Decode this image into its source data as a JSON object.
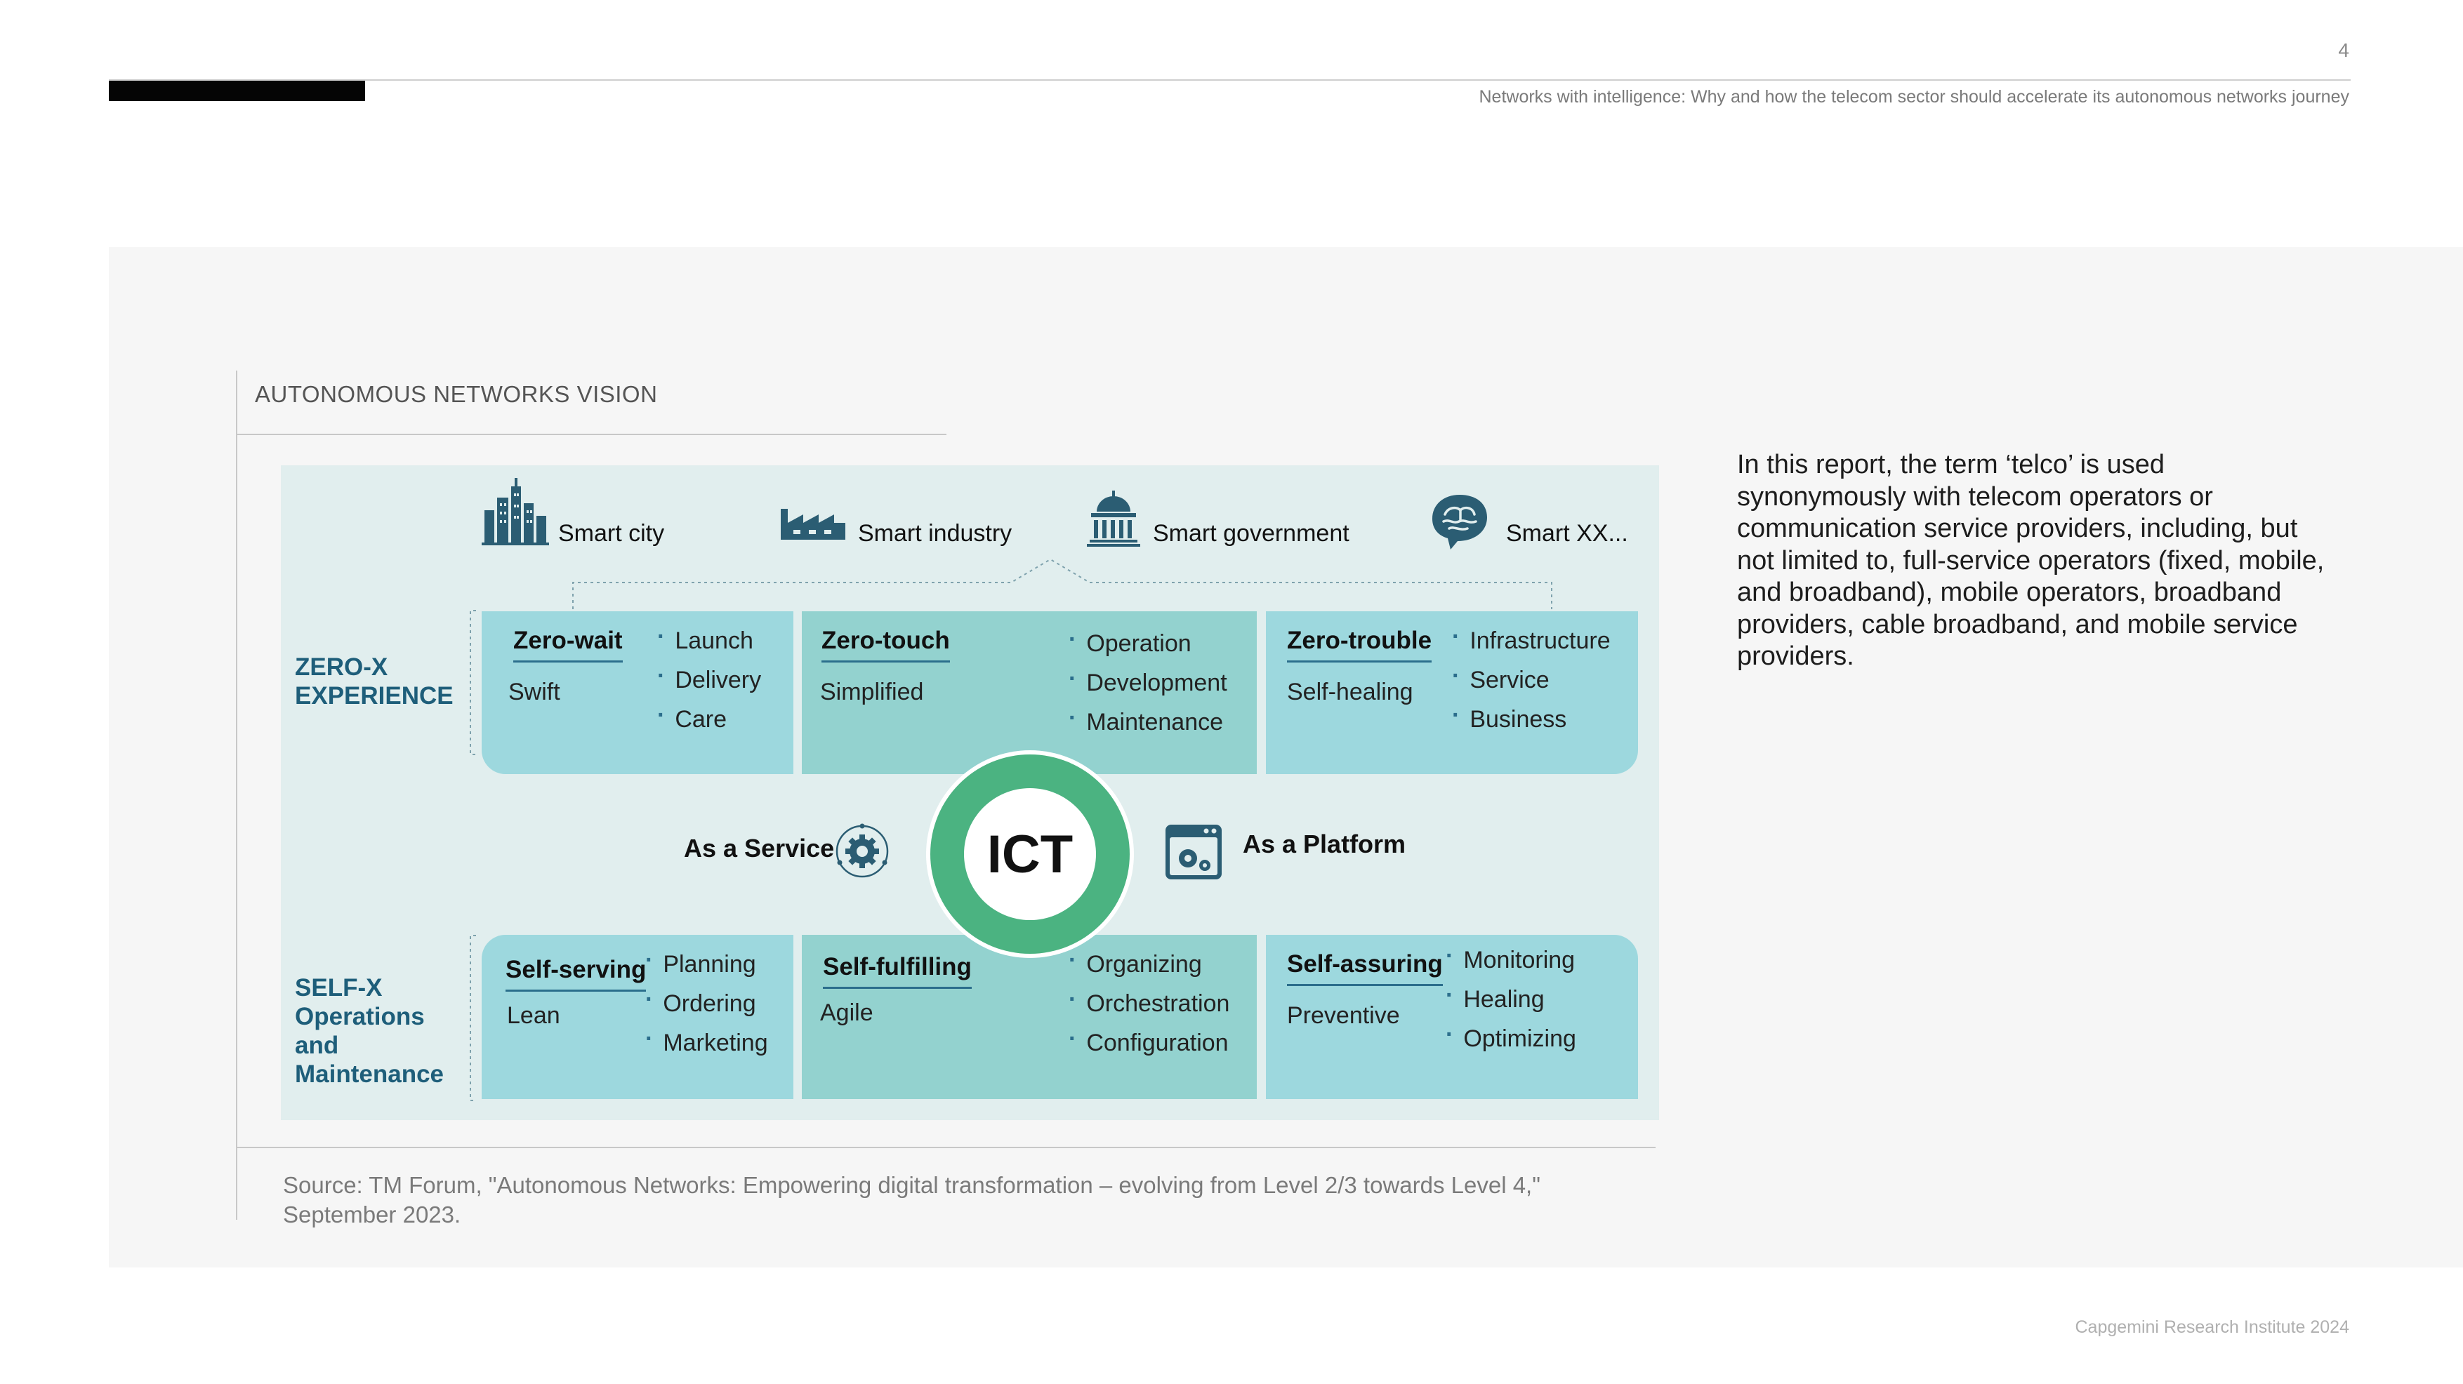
{
  "header": {
    "page_number": "4",
    "subtitle": "Networks with intelligence:  Why and how the telecom sector should accelerate its autonomous networks journey"
  },
  "figure": {
    "title": "AUTONOMOUS NETWORKS VISION",
    "source": "Source: TM Forum, \"Autonomous Networks: Empowering digital transformation – evolving from Level 2/3 towards Level 4,\" September 2023."
  },
  "diagram": {
    "smart_items": [
      {
        "label": "Smart city",
        "icon": "city-icon"
      },
      {
        "label": "Smart industry",
        "icon": "factory-icon"
      },
      {
        "label": "Smart government",
        "icon": "government-building-icon"
      },
      {
        "label": "Smart XX...",
        "icon": "brain-icon"
      }
    ],
    "zero_x_label": "ZERO-X EXPERIENCE",
    "self_x_label": "SELF-X Operations and Maintenance",
    "zero_boxes": [
      {
        "title": "Zero-wait",
        "subtitle": "Swift",
        "items": [
          "Launch",
          "Delivery",
          "Care"
        ]
      },
      {
        "title": "Zero-touch",
        "subtitle": "Simplified",
        "items": [
          "Operation",
          "Development",
          "Maintenance"
        ]
      },
      {
        "title": "Zero-trouble",
        "subtitle": "Self-healing",
        "items": [
          "Infrastructure",
          "Service",
          "Business"
        ]
      }
    ],
    "self_boxes": [
      {
        "title": "Self-serving",
        "subtitle": "Lean",
        "items": [
          "Planning",
          "Ordering",
          "Marketing"
        ]
      },
      {
        "title": "Self-fulfilling",
        "subtitle": "Agile",
        "items": [
          "Organizing",
          "Orchestration",
          "Configuration"
        ]
      },
      {
        "title": "Self-assuring",
        "subtitle": "Preventive",
        "items": [
          "Monitoring",
          "Healing",
          "Optimizing"
        ]
      }
    ],
    "center_label": "ICT",
    "as_service": "As a Service",
    "as_platform": "As a Platform",
    "colors": {
      "background": "#e1eeee",
      "box_light": "#9dd8de",
      "box_mid": "#93d2cf",
      "ring": "#4bb381",
      "label_blue": "#1e5e7a",
      "icon": "#2b5d73"
    }
  },
  "paragraph": "In this report, the term ‘telco’ is used synonymously with telecom operators or communication service providers, including, but not limited to, full-service operators (fixed, mobile, and broadband), mobile operators, broadband providers, cable broadband, and mobile service providers.",
  "footer": "Capgemini Research Institute 2024"
}
